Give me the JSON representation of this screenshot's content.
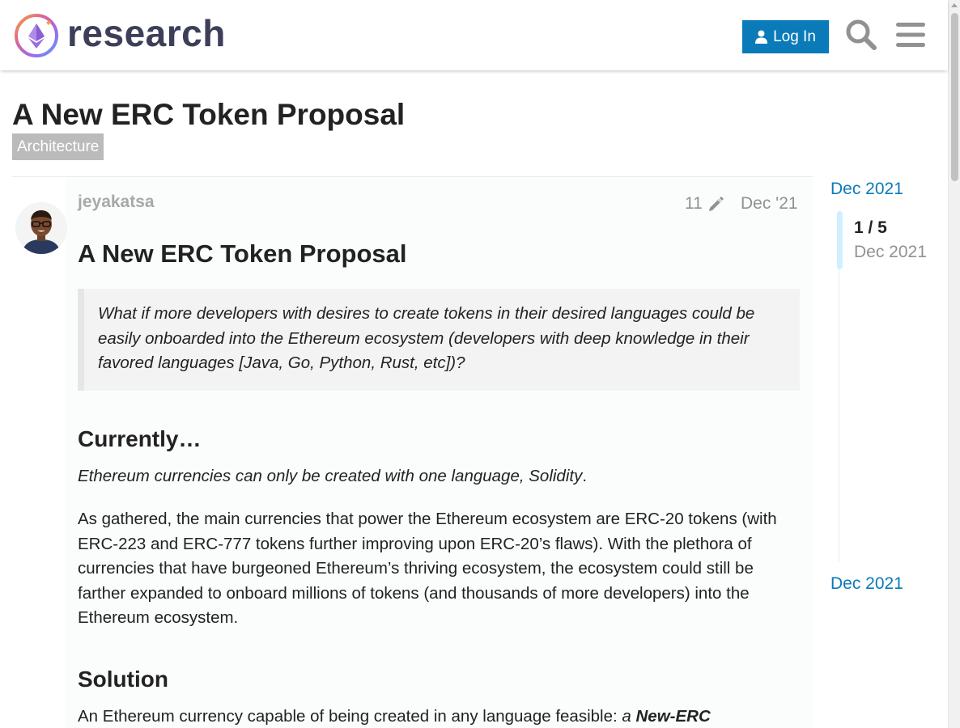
{
  "header": {
    "logo_text": "research",
    "login_label": "Log In",
    "icons": [
      "user-icon",
      "search-icon",
      "hamburger-menu-icon"
    ]
  },
  "topic": {
    "title": "A New ERC Token Proposal",
    "category": "Architecture"
  },
  "post": {
    "username": "jeyakatsa",
    "edit_count": "11",
    "date": "Dec '21",
    "heading": "A New ERC Token Proposal",
    "quote": "What if more developers with desires to create tokens in their desired languages could be easily onboarded into the Ethereum ecosystem (developers with deep knowledge in their favored languages [Java, Go, Python, Rust, etc])?",
    "section1_heading": "Currently…",
    "section1_italic": "Ethereum currencies can only be created with one language, Solidity",
    "section1_period": ".",
    "section1_para": "As gathered, the main currencies that power the Ethereum ecosystem are ERC-20 tokens (with ERC-223 and ERC-777 tokens further improving upon ERC-20’s flaws). With the plethora of currencies that have burgeoned Ethereum’s thriving ecosystem, the ecosystem could still be farther expanded to onboard millions of tokens (and thousands of more developers) into the Ethereum ecosystem.",
    "section2_heading": "Solution",
    "section2_text": "An Ethereum currency capable of being created in any language feasible: ",
    "section2_italic": "a ",
    "section2_bold_italic": "New-ERC"
  },
  "timeline": {
    "top_date": "Dec 2021",
    "position": "1 / 5",
    "handle_date": "Dec 2021",
    "bottom_date": "Dec 2021"
  },
  "colors": {
    "accent": "#0a7ab9",
    "logo_text": "#3d3f5a",
    "muted": "#919191",
    "category_bg": "#bbbbbb",
    "timeline_handle": "#d1f0ff"
  }
}
